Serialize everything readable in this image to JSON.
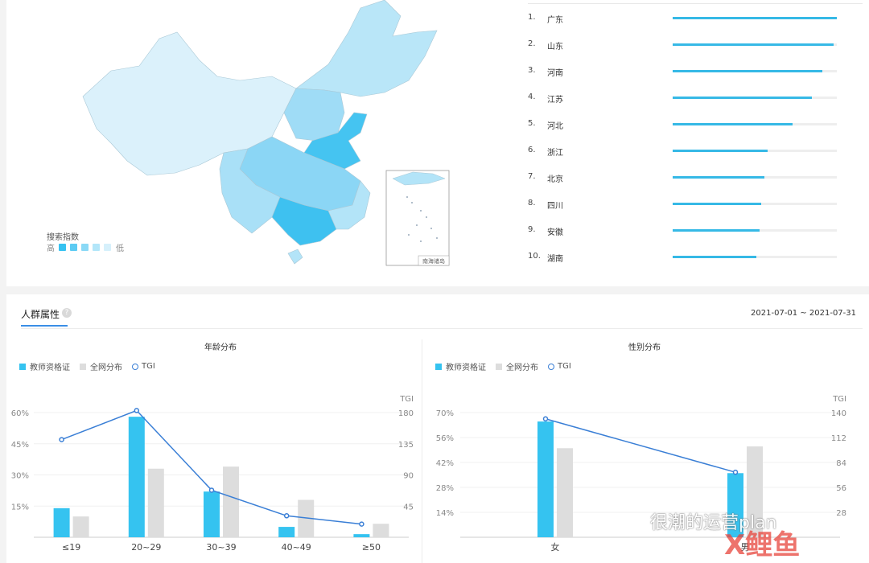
{
  "map": {
    "legend_title": "搜索指数",
    "legend_high": "高",
    "legend_low": "低",
    "legend_colors": [
      "#36c2f1",
      "#5ccbf3",
      "#8ad9f6",
      "#b3e6f9",
      "#d6f0fb"
    ],
    "inset_label": "南海诸岛"
  },
  "ranking": [
    {
      "num": "1.",
      "name": "广东",
      "value": 1.0
    },
    {
      "num": "2.",
      "name": "山东",
      "value": 0.98
    },
    {
      "num": "3.",
      "name": "河南",
      "value": 0.91
    },
    {
      "num": "4.",
      "name": "江苏",
      "value": 0.85
    },
    {
      "num": "5.",
      "name": "河北",
      "value": 0.73
    },
    {
      "num": "6.",
      "name": "浙江",
      "value": 0.58
    },
    {
      "num": "7.",
      "name": "北京",
      "value": 0.56
    },
    {
      "num": "8.",
      "name": "四川",
      "value": 0.54
    },
    {
      "num": "9.",
      "name": "安徽",
      "value": 0.53
    },
    {
      "num": "10.",
      "name": "湖南",
      "value": 0.51
    }
  ],
  "section": {
    "title": "人群属性",
    "help": "?",
    "date_range": "2021-07-01 ~ 2021-07-31"
  },
  "legend_labels": {
    "a": "教师资格证",
    "b": "全网分布",
    "c": "TGI"
  },
  "colors": {
    "a": "#35c3f0",
    "b": "#dddddd",
    "line": "#3a7fd6"
  },
  "chart_data": [
    {
      "type": "bar",
      "title": "年龄分布",
      "categories": [
        "≤19",
        "20~29",
        "30~39",
        "40~49",
        "≥50"
      ],
      "y_ticks": [
        "15%",
        "30%",
        "45%",
        "60%"
      ],
      "y2_ticks": [
        "45",
        "90",
        "135",
        "180"
      ],
      "y2_label": "TGI",
      "ylim": [
        0,
        60
      ],
      "y2lim": [
        0,
        180
      ],
      "series": [
        {
          "name": "教师资格证",
          "values": [
            14,
            58,
            22,
            5,
            1.5
          ]
        },
        {
          "name": "全网分布",
          "values": [
            10,
            33,
            34,
            18,
            6.5
          ]
        },
        {
          "name": "TGI",
          "values": [
            141,
            183,
            68,
            31,
            19
          ]
        }
      ]
    },
    {
      "type": "bar",
      "title": "性别分布",
      "categories": [
        "女",
        "男"
      ],
      "y_ticks": [
        "14%",
        "28%",
        "42%",
        "56%",
        "70%"
      ],
      "y2_ticks": [
        "28",
        "56",
        "84",
        "112",
        "140"
      ],
      "y2_label": "TGI",
      "ylim": [
        0,
        70
      ],
      "y2lim": [
        0,
        140
      ],
      "series": [
        {
          "name": "教师资格证",
          "values": [
            65,
            36
          ]
        },
        {
          "name": "全网分布",
          "values": [
            50,
            51
          ]
        },
        {
          "name": "TGI",
          "values": [
            133,
            73
          ]
        }
      ]
    }
  ],
  "watermark": "很潮的运营plan",
  "logo": "X鲤鱼"
}
